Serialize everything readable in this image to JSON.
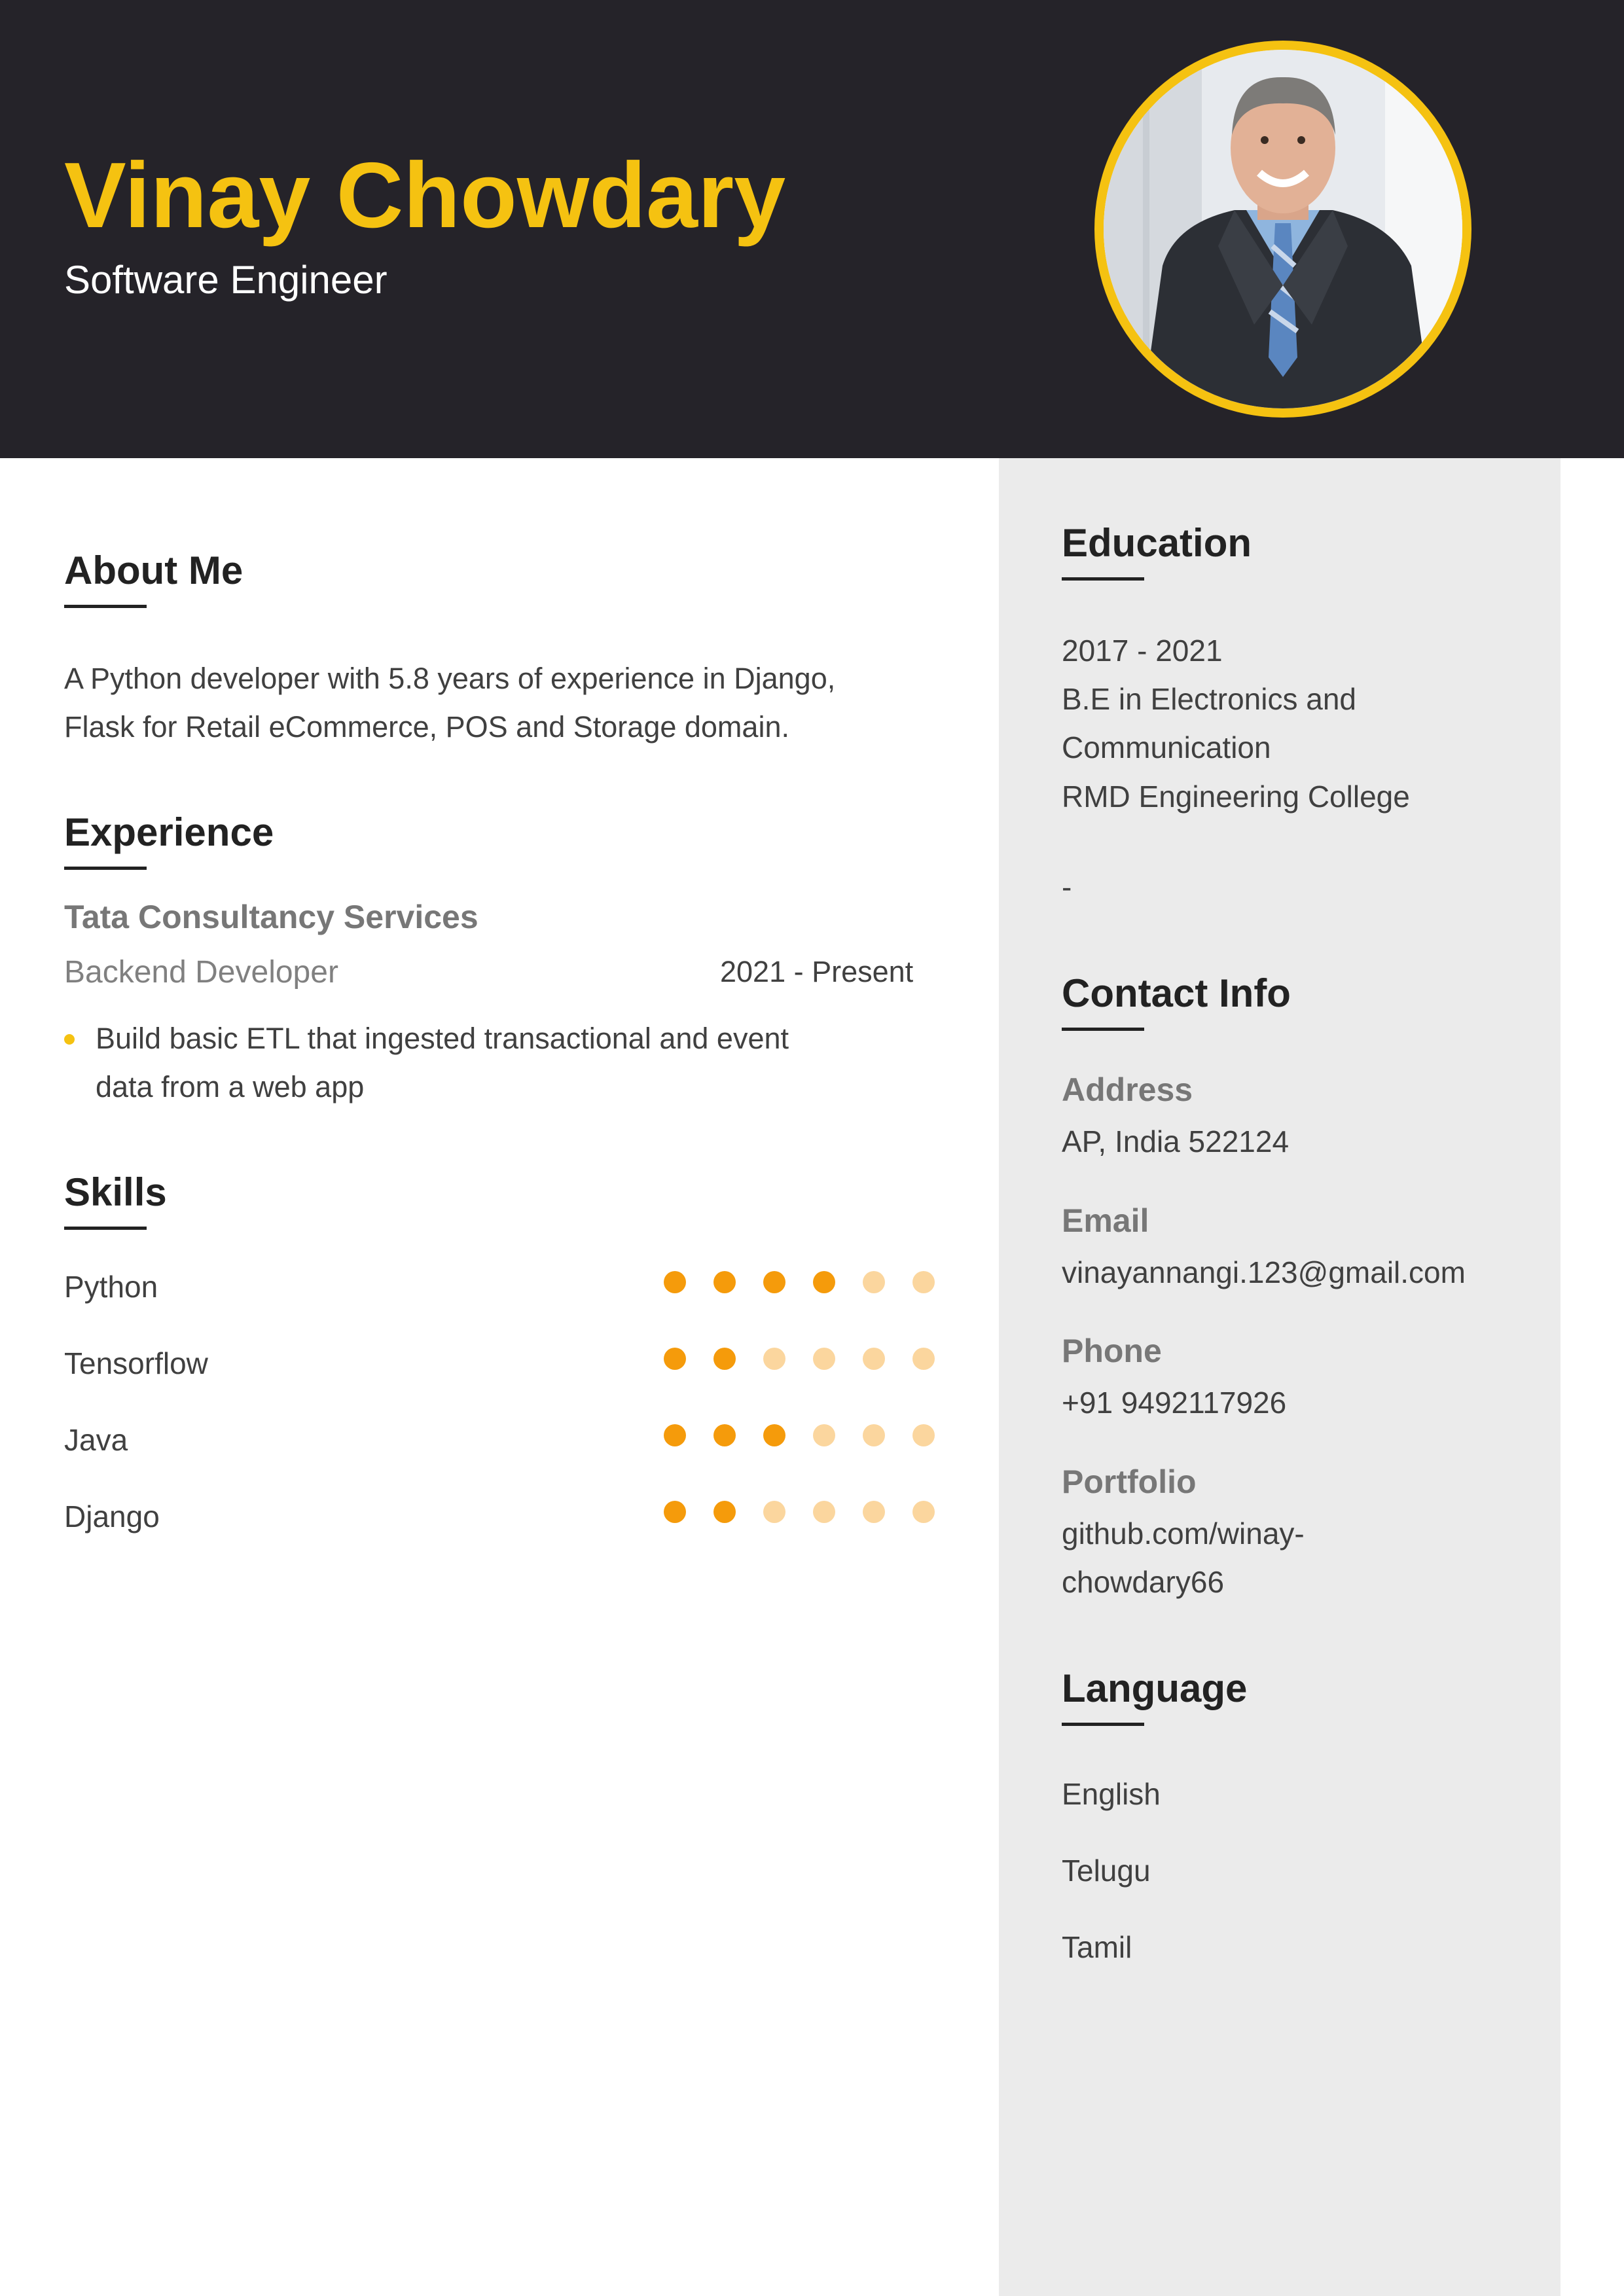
{
  "header": {
    "name": "Vinay Chowdary",
    "title": "Software Engineer"
  },
  "about": {
    "heading": "About Me",
    "line1": "A Python developer with 5.8 years of experience in Django,",
    "line2": "Flask for Retail eCommerce, POS and Storage domain."
  },
  "experience": {
    "heading": "Experience",
    "company": "Tata Consultancy Services",
    "role": "Backend Developer",
    "period": "2021 - Present",
    "bullet_line1": "Build basic ETL that ingested transactional and event",
    "bullet_line2": "data from a web app"
  },
  "skills": {
    "heading": "Skills",
    "max": 6,
    "items": [
      {
        "name": "Python",
        "level": 4
      },
      {
        "name": "Tensorflow",
        "level": 2
      },
      {
        "name": "Java",
        "level": 3
      },
      {
        "name": "Django",
        "level": 2
      }
    ]
  },
  "education": {
    "heading": "Education",
    "years": "2017 - 2021",
    "degree_line1": "B.E in Electronics and",
    "degree_line2": "Communication",
    "college": "RMD Engineering College",
    "extra": "-"
  },
  "contact": {
    "heading": "Contact Info",
    "address_label": "Address",
    "address": "AP, India 522124",
    "email_label": "Email",
    "email": "vinayannangi.123@gmail.com",
    "phone_label": "Phone",
    "phone": "+91 9492117926",
    "portfolio_label": "Portfolio",
    "portfolio_line1": "github.com/winay-",
    "portfolio_line2": "chowdary66"
  },
  "language": {
    "heading": "Language",
    "items": [
      "English",
      "Telugu",
      "Tamil"
    ]
  },
  "colors": {
    "accent": "#f5c211",
    "header_bg": "#252329",
    "sidebar_bg": "#ebebeb",
    "skill_on": "#f59b0b",
    "skill_off": "#fbd69e"
  }
}
